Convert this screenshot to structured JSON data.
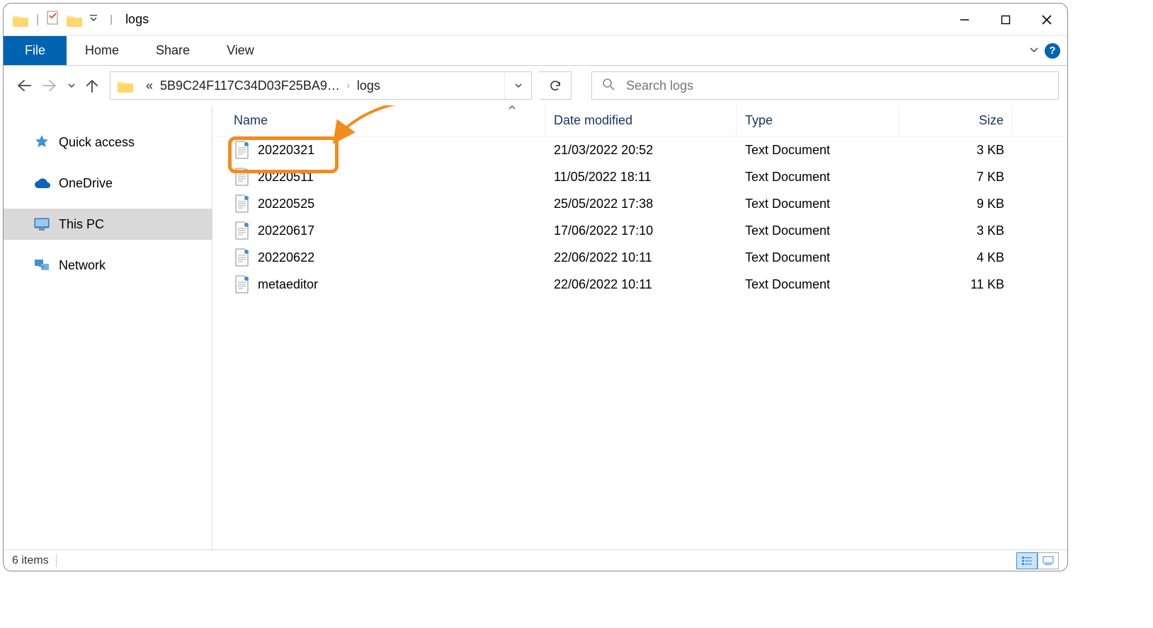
{
  "titlebar": {
    "title": "logs"
  },
  "ribbon": {
    "tabs": {
      "file": "File",
      "home": "Home",
      "share": "Share",
      "view": "View"
    }
  },
  "address": {
    "crumb_prefix": "«",
    "crumb_parent": "5B9C24F117C34D03F25BA9…",
    "crumb_current": "logs"
  },
  "search": {
    "placeholder": "Search logs"
  },
  "nav": {
    "items": [
      {
        "label": "Quick access",
        "icon": "star"
      },
      {
        "label": "OneDrive",
        "icon": "cloud"
      },
      {
        "label": "This PC",
        "icon": "monitor",
        "selected": true
      },
      {
        "label": "Network",
        "icon": "network"
      }
    ]
  },
  "columns": {
    "name": "Name",
    "date": "Date modified",
    "type": "Type",
    "size": "Size"
  },
  "files": [
    {
      "name": "20220321",
      "date": "21/03/2022 20:52",
      "type": "Text Document",
      "size": "3 KB",
      "highlighted": true
    },
    {
      "name": "20220511",
      "date": "11/05/2022 18:11",
      "type": "Text Document",
      "size": "7 KB"
    },
    {
      "name": "20220525",
      "date": "25/05/2022 17:38",
      "type": "Text Document",
      "size": "9 KB"
    },
    {
      "name": "20220617",
      "date": "17/06/2022 17:10",
      "type": "Text Document",
      "size": "3 KB"
    },
    {
      "name": "20220622",
      "date": "22/06/2022 10:11",
      "type": "Text Document",
      "size": "4 KB"
    },
    {
      "name": "metaeditor",
      "date": "22/06/2022 10:11",
      "type": "Text Document",
      "size": "11 KB"
    }
  ],
  "status": {
    "items": "6 items"
  }
}
